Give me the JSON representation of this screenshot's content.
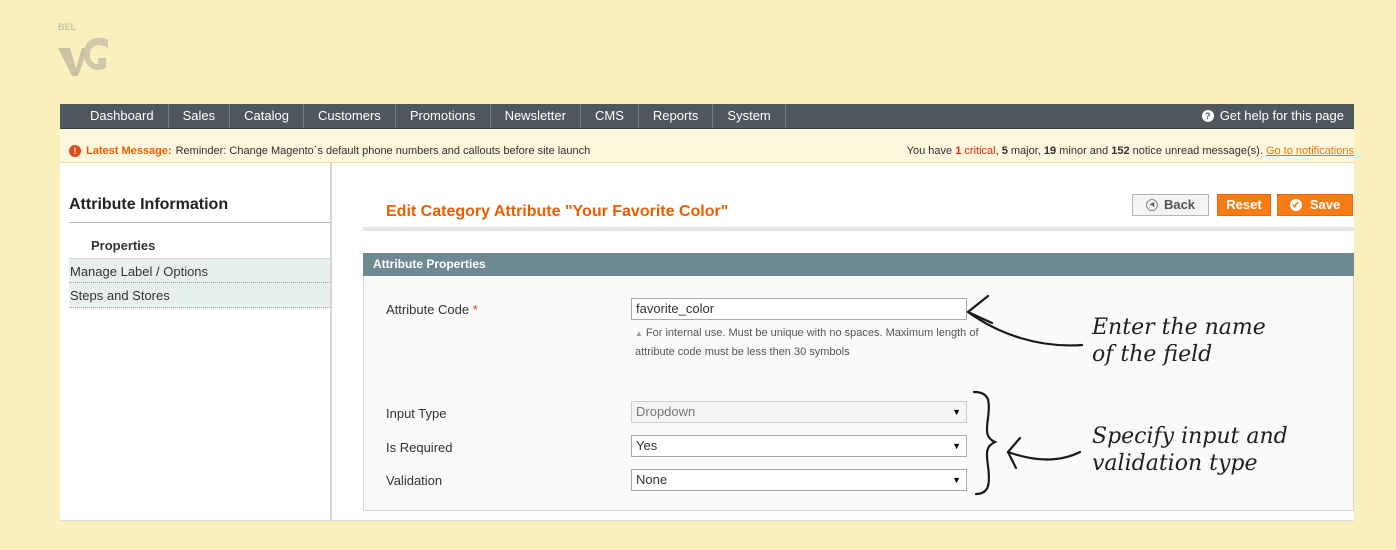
{
  "nav": {
    "items": [
      "Dashboard",
      "Sales",
      "Catalog",
      "Customers",
      "Promotions",
      "Newsletter",
      "CMS",
      "Reports",
      "System"
    ],
    "help": "Get help for this page"
  },
  "message_bar": {
    "label": "Latest Message:",
    "text": "Reminder: Change Magento`s default phone numbers and callouts before site launch",
    "summary": {
      "prefix": "You have",
      "critical_count": "1",
      "critical_label": "critical",
      "major_count": "5",
      "major_label": "major,",
      "minor_count": "19",
      "minor_label": "minor and",
      "notice_count": "152",
      "notice_label": "notice unread message(s).",
      "link": "Go to notifications"
    }
  },
  "sidebar": {
    "title": "Attribute Information",
    "items": [
      "Properties",
      "Manage Label / Options",
      "Steps and Stores"
    ]
  },
  "page": {
    "title": "Edit Category Attribute \"Your Favorite Color\"",
    "buttons": {
      "back": "Back",
      "reset": "Reset",
      "save": "Save"
    }
  },
  "fieldset": {
    "title": "Attribute Properties",
    "attribute_code_label": "Attribute Code",
    "attribute_code_required": "*",
    "attribute_code_value": "favorite_color",
    "note": "For internal use. Must be unique with no spaces. Maximum length of attribute code must be less then 30 symbols",
    "input_type_label": "Input Type",
    "input_type_value": "Dropdown",
    "is_required_label": "Is Required",
    "is_required_value": "Yes",
    "validation_label": "Validation",
    "validation_value": "None"
  },
  "annotations": {
    "name_note": "Enter the name\nof the field",
    "type_note": "Specify input and\nvalidation type"
  },
  "colors": {
    "accent": "#eb5e00",
    "button": "#f77c16",
    "nav": "#4f575c",
    "fieldset_header": "#6f8992",
    "background": "#faf0be"
  }
}
